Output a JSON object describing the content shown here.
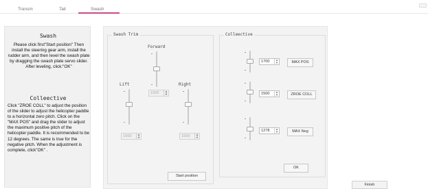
{
  "tabs": [
    {
      "label": "Transm"
    },
    {
      "label": "Tail"
    },
    {
      "label": "Swash",
      "active": true
    }
  ],
  "accent_color": "#c9488f",
  "help": {
    "swash_title": "Swash",
    "swash_text": "Please click first\"Start position\" Then install the steering gear arm, install the rudder arm, and then level the swash plate by dragging the swash plate servo slider. After leveling, click:\"OK\"",
    "collective_title": "Colleective",
    "collective_text": "Click \"ZROE COLL\" to adjust the position of the slider to adjust the helicopter paddle to a horizontal zero pitch. Click on the \"MAX POS\" and drag the slider to adjust the maximum positive pitch of the helicopter paddle. It is recommended to be 12 degrees. The same is true for the negative pitch. When the adjustment is complete, click\"OK\" ."
  },
  "swash_trim": {
    "title": "Swash Trim",
    "forward_label": "Forward",
    "left_label": "Lift",
    "right_label": "Right",
    "forward_value": "1500",
    "left_value": "1500",
    "right_value": "1500",
    "start_position_label": "Start position"
  },
  "collective": {
    "title": "Colleective",
    "max_pos_value": "1700",
    "zero_coll_value": "1500",
    "max_neg_value": "1278",
    "max_pos_label": "MAX POS",
    "zero_coll_label": "ZROE COLL",
    "max_neg_label": "MAX Neg",
    "ok_label": "OK"
  },
  "finish_label": "Finish",
  "icons": {
    "spin_up": "▲",
    "spin_down": "▼"
  }
}
